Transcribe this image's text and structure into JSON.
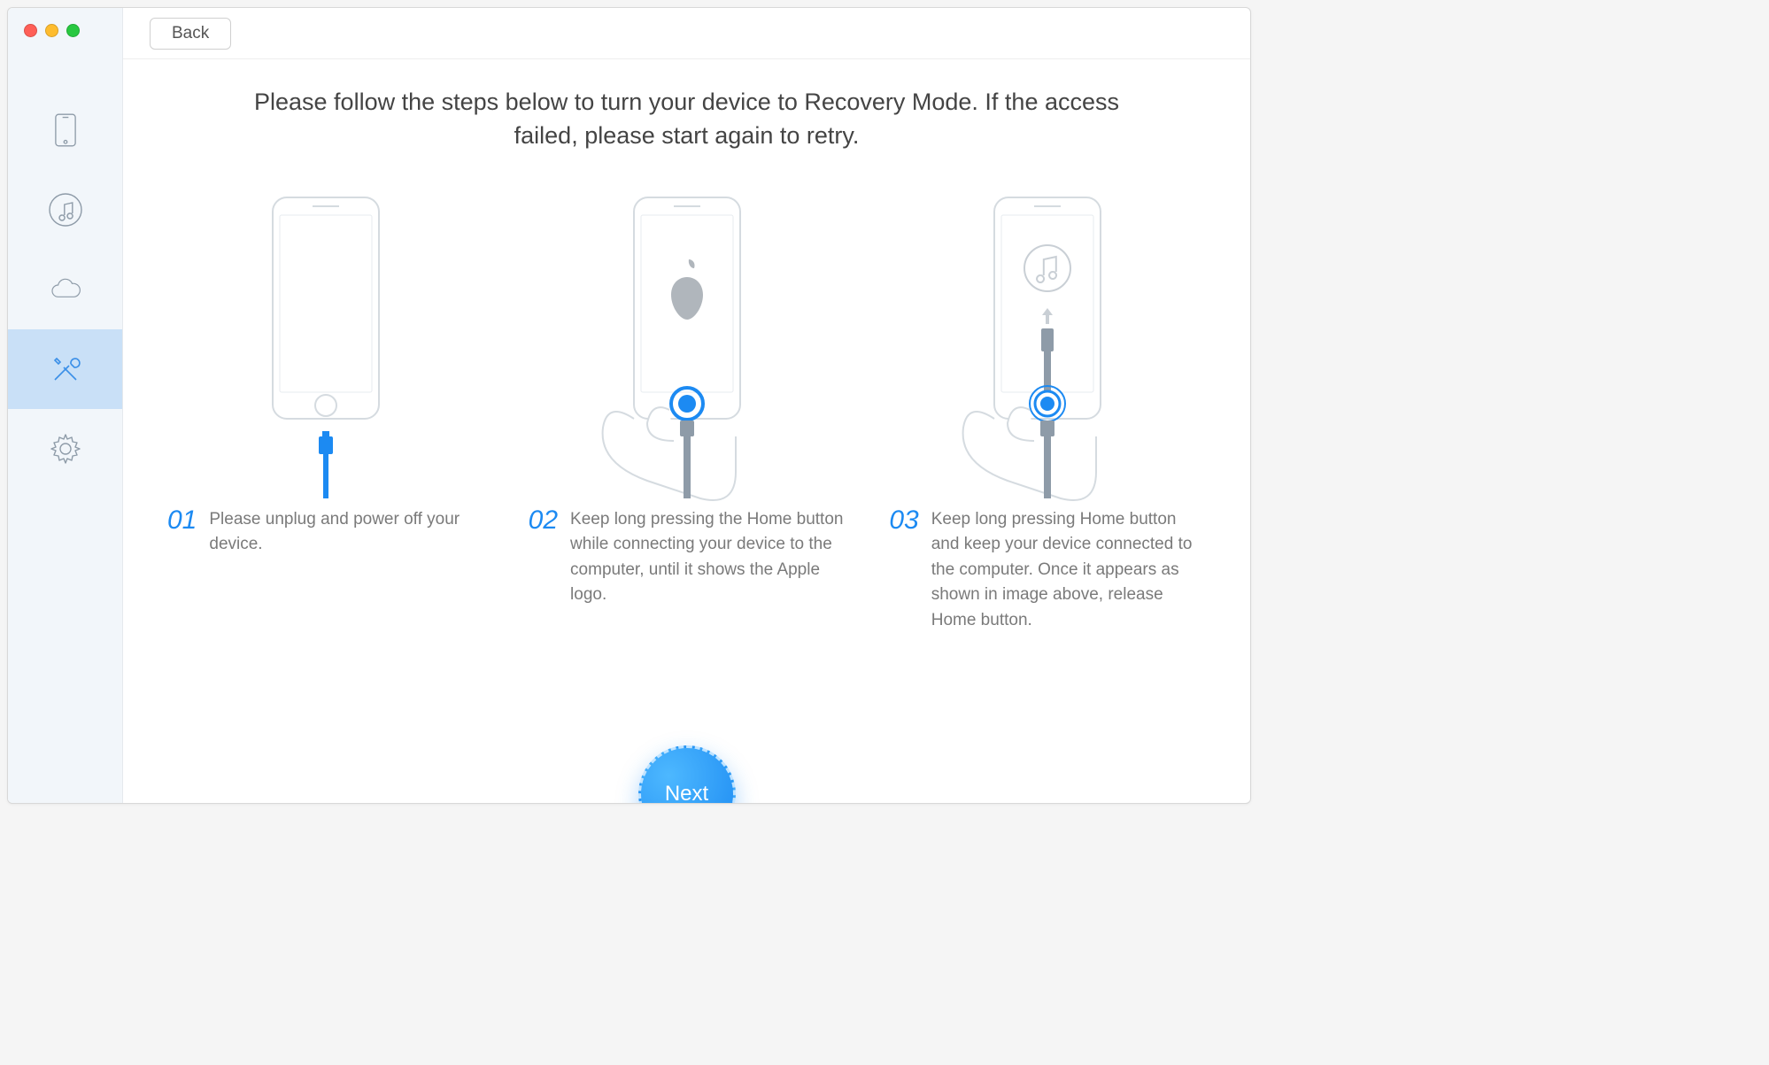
{
  "toolbar": {
    "back_label": "Back"
  },
  "instructions": {
    "title": "Please follow the steps below to turn your device to Recovery Mode. If the access failed, please start again to retry."
  },
  "steps": [
    {
      "number": "01",
      "text": "Please unplug and power off your device."
    },
    {
      "number": "02",
      "text": "Keep long pressing the Home button while connecting your device to the computer, until it shows the Apple logo."
    },
    {
      "number": "03",
      "text": "Keep long pressing Home button and keep your device connected to the computer. Once it appears as shown in image above, release Home button."
    }
  ],
  "next_label": "Next",
  "sidebar": {
    "items": [
      "device",
      "itunes",
      "icloud",
      "tools",
      "settings"
    ],
    "active_index": 3
  }
}
